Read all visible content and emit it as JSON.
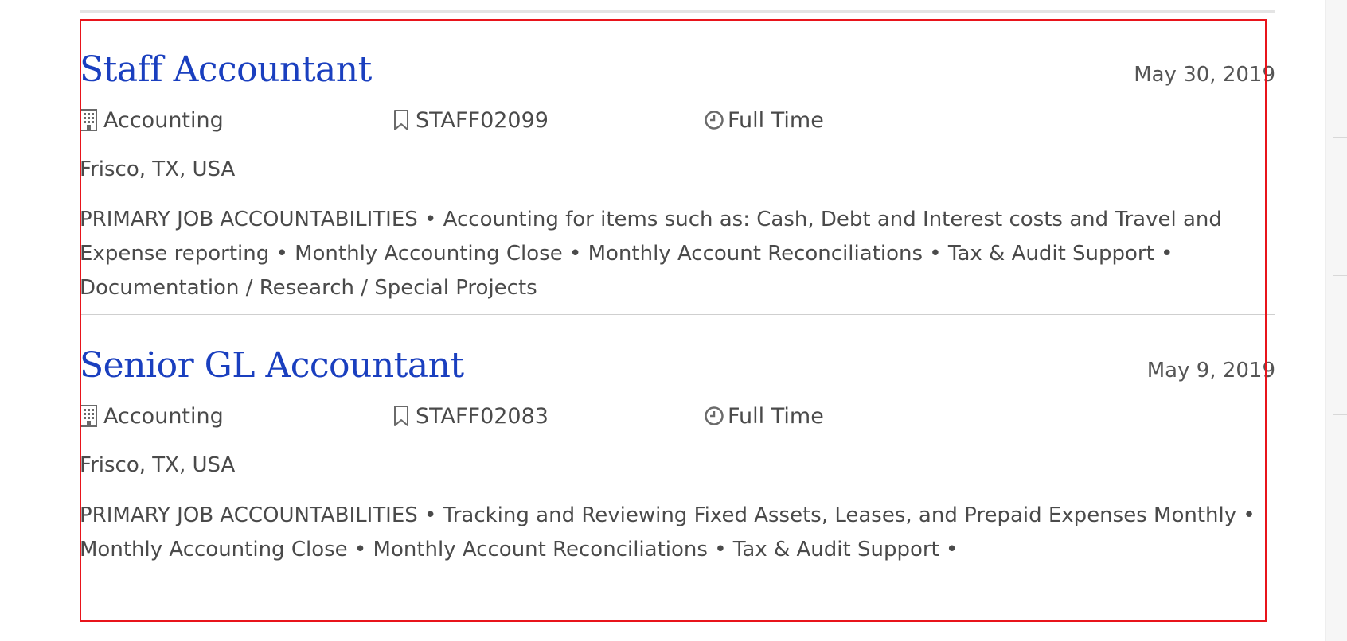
{
  "jobs": [
    {
      "title": "Staff Accountant",
      "date": "May 30, 2019",
      "department": "Accounting",
      "code": "STAFF02099",
      "type": "Full Time",
      "location": "Frisco, TX, USA",
      "description": "PRIMARY JOB ACCOUNTABILITIES • Accounting for items such as: Cash, Debt and Interest costs and Travel and Expense reporting • Monthly Accounting Close • Monthly Account Reconciliations • Tax & Audit Support • Documentation / Research / Special Projects"
    },
    {
      "title": "Senior GL Accountant",
      "date": "May 9, 2019",
      "department": "Accounting",
      "code": "STAFF02083",
      "type": "Full Time",
      "location": "Frisco, TX, USA",
      "description": "PRIMARY JOB ACCOUNTABILITIES • Tracking and Reviewing Fixed Assets, Leases, and Prepaid Expenses Monthly • Monthly Accounting Close • Monthly Account Reconciliations • Tax & Audit Support •"
    }
  ],
  "icons": {
    "department": "building-icon",
    "code": "bookmark-icon",
    "type": "clock-icon"
  },
  "colors": {
    "title": "#1a3fbf",
    "text": "#4a4a4a",
    "highlight_border": "#e8141b"
  }
}
